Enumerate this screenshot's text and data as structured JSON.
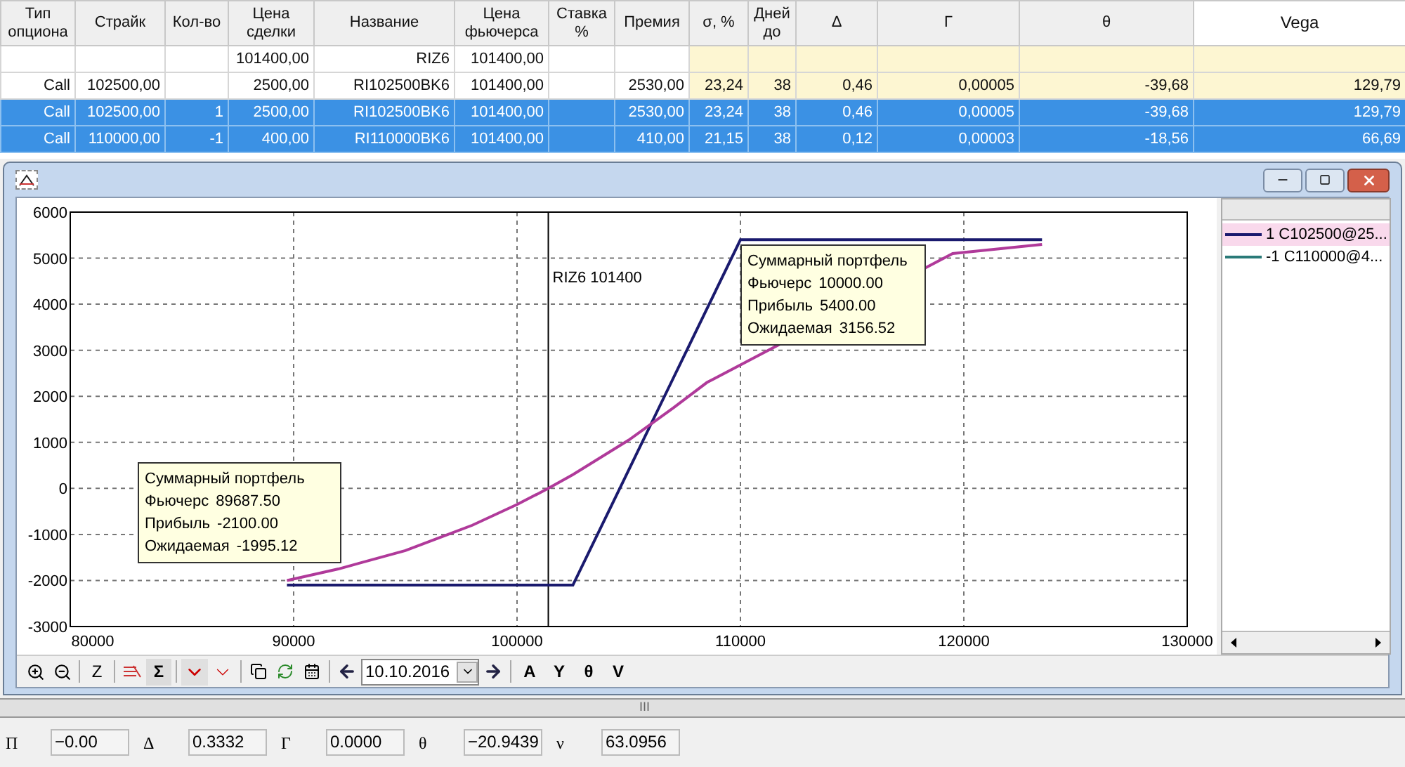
{
  "table": {
    "columns": [
      {
        "label": "Тип опциона",
        "selected": false
      },
      {
        "label": "Страйк",
        "selected": false
      },
      {
        "label": "Кол-во",
        "selected": false
      },
      {
        "label": "Цена сделки",
        "selected": false
      },
      {
        "label": "Название",
        "selected": false
      },
      {
        "label": "Цена фьючерса",
        "selected": false
      },
      {
        "label": "Ставка %",
        "selected": false
      },
      {
        "label": "Премия",
        "selected": false
      },
      {
        "label": "σ, %",
        "selected": false
      },
      {
        "label": "Дней до",
        "selected": false
      },
      {
        "label": "Δ",
        "selected": false
      },
      {
        "label": "Γ",
        "selected": false
      },
      {
        "label": "θ",
        "selected": false
      },
      {
        "label": "Vega",
        "selected": true
      }
    ],
    "rows": [
      {
        "selected": false,
        "cells": [
          null,
          null,
          null,
          "101400,00",
          "RIZ6",
          "101400,00",
          null,
          null,
          null,
          null,
          null,
          null,
          null,
          null
        ]
      },
      {
        "selected": false,
        "cells": [
          "Call",
          "102500,00",
          null,
          "2500,00",
          "RI102500BK6",
          "101400,00",
          null,
          "2530,00",
          "23,24",
          "38",
          "0,46",
          "0,00005",
          "-39,68",
          "129,79"
        ]
      },
      {
        "selected": true,
        "cells": [
          "Call",
          "102500,00",
          "1",
          "2500,00",
          "RI102500BK6",
          "101400,00",
          null,
          "2530,00",
          "23,24",
          "38",
          "0,46",
          "0,00005",
          "-39,68",
          "129,79"
        ]
      },
      {
        "selected": true,
        "cells": [
          "Call",
          "110000,00",
          "-1",
          "400,00",
          "RI110000BK6",
          "101400,00",
          null,
          "410,00",
          "21,15",
          "38",
          "0,12",
          "0,00003",
          "-18,56",
          "66,69"
        ]
      }
    ]
  },
  "chart": {
    "chart_data": {
      "type": "line",
      "x": [
        89700,
        92000,
        95000,
        98000,
        100000,
        101400,
        102500,
        105000,
        107000,
        108500,
        110000,
        119500,
        121500,
        123500
      ],
      "series": [
        {
          "color": "#1a1a6e",
          "values": [
            -2100,
            -2100,
            -2100,
            -2100,
            -2100,
            -2100,
            -2100,
            400,
            2400,
            3900,
            5400,
            5400,
            5400,
            5400
          ]
        },
        {
          "color": "#b03a9a",
          "values": [
            -2000,
            -1750,
            -1350,
            -800,
            -350,
            0,
            300,
            1050,
            1750,
            2300,
            null,
            5100,
            5200,
            5300
          ]
        }
      ],
      "xlim": [
        80000,
        130000
      ],
      "ylim": [
        -3000,
        6000
      ],
      "xticks": [
        80000,
        90000,
        100000,
        110000,
        120000,
        130000
      ],
      "yticks": [
        -3000,
        -2000,
        -1000,
        0,
        1000,
        2000,
        3000,
        4000,
        5000,
        6000
      ],
      "grid": true,
      "ref_lines": [
        {
          "axis": "x",
          "value": 101400,
          "color": "#000000"
        }
      ],
      "annotations": [
        "RIZ6 101400"
      ]
    },
    "tooltips": [
      {
        "title": "Суммарный портфель",
        "rows": [
          {
            "label": "Фьючерс",
            "value": "89687.50"
          },
          {
            "label": "Прибыль",
            "value": "-2100.00"
          },
          {
            "label": "Ожидаемая",
            "value": "-1995.12"
          }
        ]
      },
      {
        "title": "Суммарный портфель",
        "rows": [
          {
            "label": "Фьючерс",
            "value": "10000.00"
          },
          {
            "label": "Прибыль",
            "value": "5400.00"
          },
          {
            "label": "Ожидаемая",
            "value": "3156.52"
          }
        ]
      }
    ],
    "legend": [
      {
        "label": "1 C102500@25...",
        "color": "#1a1a6e",
        "selected": true
      },
      {
        "label": "-1 C110000@4...",
        "color": "#2a7a78",
        "selected": false
      }
    ]
  },
  "toolbar": {
    "zoom_label": "Z",
    "sum_label": "Σ",
    "date": "10.10.2016",
    "greek_buttons": [
      "A",
      "Y",
      "θ",
      "V"
    ]
  },
  "splitter": {
    "grip": "III"
  },
  "status_bar": [
    {
      "label": "Π",
      "value": "−0.00"
    },
    {
      "label": "Δ",
      "value": "0.3332"
    },
    {
      "label": "Γ",
      "value": "0.0000"
    },
    {
      "label": "θ",
      "value": "−20.9439"
    },
    {
      "label": "ν",
      "value": "63.0956"
    }
  ]
}
